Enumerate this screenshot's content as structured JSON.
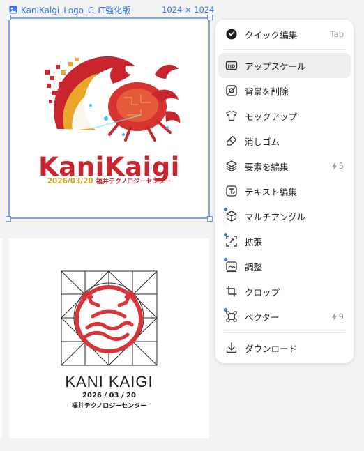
{
  "canvas": {
    "image_name": "KaniKaigi_Logo_C_IT強化版",
    "image_size": "1024 × 1024"
  },
  "logo1": {
    "title": "KaniKaigi",
    "date": "2026/03/20",
    "venue": "福井テクノロジーセンター"
  },
  "logo2": {
    "title": "KANI KAIGI",
    "date": "2026 / 03 / 20",
    "venue": "福井テクノロジーセンター"
  },
  "menu": {
    "items": [
      {
        "label": "クイック編集",
        "icon": "quick-edit-icon",
        "shortcut": "Tab"
      },
      {
        "label": "アップスケール",
        "icon": "hd-icon",
        "active": true
      },
      {
        "label": "背景を削除",
        "icon": "remove-background-icon"
      },
      {
        "label": "モックアップ",
        "icon": "tshirt-icon"
      },
      {
        "label": "消しゴム",
        "icon": "eraser-icon"
      },
      {
        "label": "要素を編集",
        "icon": "layers-icon",
        "credits": "5"
      },
      {
        "label": "テキスト編集",
        "icon": "text-edit-icon"
      },
      {
        "label": "マルチアングル",
        "icon": "cube-icon",
        "new_dot": true
      },
      {
        "label": "拡張",
        "icon": "expand-icon",
        "new_dot": true
      },
      {
        "label": "調整",
        "icon": "adjust-icon",
        "new_dot": true
      },
      {
        "label": "クロップ",
        "icon": "crop-icon"
      },
      {
        "label": "ベクター",
        "icon": "vector-icon",
        "new_dot": true,
        "credits": "9"
      },
      {
        "label": "ダウンロード",
        "icon": "download-icon"
      }
    ]
  },
  "colors": {
    "selection": "#3b73e8",
    "logo_red": "#c8252f",
    "logo_gold": "#d6a21f",
    "new_dot": "#3b73e8"
  }
}
